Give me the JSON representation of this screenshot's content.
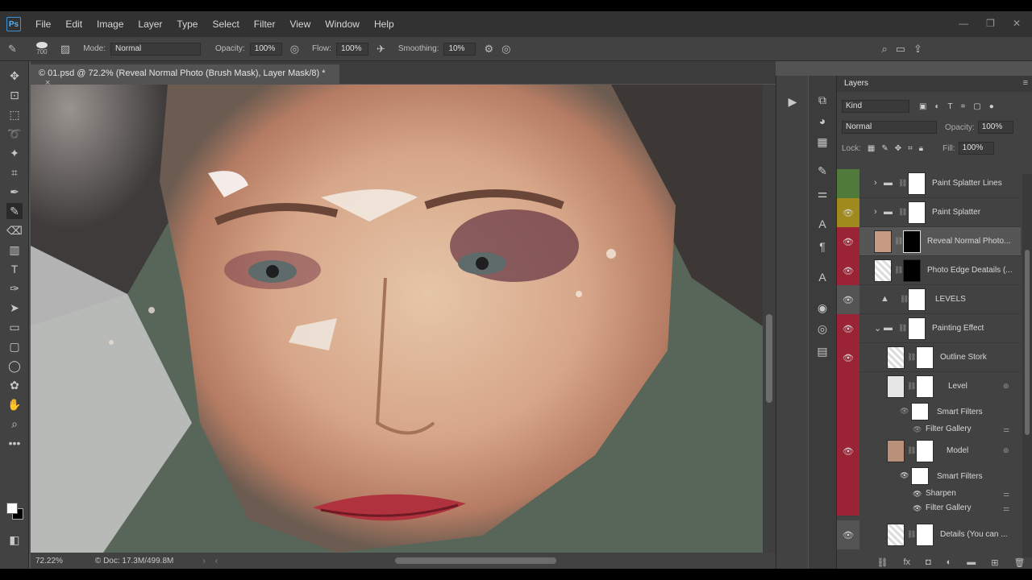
{
  "app": {
    "logo": "Ps",
    "menus": [
      "File",
      "Edit",
      "Image",
      "Layer",
      "Type",
      "Select",
      "Filter",
      "View",
      "Window",
      "Help"
    ],
    "window_controls": [
      "—",
      "❐",
      "✕"
    ]
  },
  "options": {
    "brush_size": "700",
    "mode_label": "Mode:",
    "mode_value": "Normal",
    "opacity_label": "Opacity:",
    "opacity_value": "100%",
    "flow_label": "Flow:",
    "flow_value": "100%",
    "smoothing_label": "Smoothing:",
    "smoothing_value": "10%"
  },
  "document": {
    "tab_title": "© 01.psd @ 72.2% (Reveal Normal Photo (Brush Mask), Layer Mask/8) *",
    "tab_close": "×",
    "zoom": "72.22%",
    "doc_info": "© Doc: 17.3M/499.8M"
  },
  "layers_panel": {
    "title": "Layers",
    "filter_kind": "Kind",
    "blend_mode": "Normal",
    "opacity_label": "Opacity:",
    "opacity_value": "100%",
    "lock_label": "Lock:",
    "fill_label": "Fill:",
    "fill_value": "100%",
    "layers": [
      {
        "name": "Paint Splatter Lines",
        "type": "group",
        "visible": false,
        "color": "#4f7a3a"
      },
      {
        "name": "Paint Splatter",
        "type": "group",
        "visible": true,
        "color": "#a08a1e"
      },
      {
        "name": "Reveal Normal Photo...",
        "type": "layer",
        "visible": true,
        "color": "#9a2435",
        "selected": true
      },
      {
        "name": "Photo Edge Deatails (...",
        "type": "layer",
        "visible": true,
        "color": "#9a2435"
      },
      {
        "name": "LEVELS",
        "type": "adjustment",
        "visible": true,
        "color": "#545454"
      },
      {
        "name": "Painting Effect",
        "type": "group",
        "visible": true,
        "color": "#9a2435"
      },
      {
        "name": "Outline Stork",
        "type": "layer",
        "visible": true,
        "color": "#9a2435"
      },
      {
        "name": "Level",
        "type": "smart",
        "visible": false,
        "color": "#9a2435"
      },
      {
        "name": "Model",
        "type": "smart",
        "visible": true,
        "color": "#9a2435"
      },
      {
        "name": "Details (You can ...",
        "type": "layer",
        "visible": true,
        "color": "#545454"
      }
    ],
    "sub_items": {
      "level_smart_filters": "Smart Filters",
      "level_filter_gallery": "Filter Gallery",
      "model_smart_filters": "Smart Filters",
      "model_sharpen": "Sharpen",
      "model_filter_gallery": "Filter Gallery"
    }
  }
}
